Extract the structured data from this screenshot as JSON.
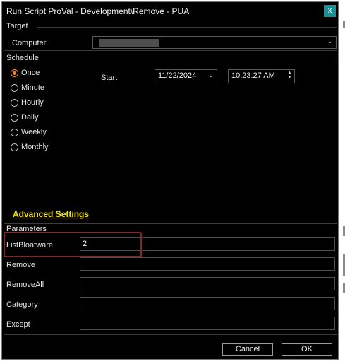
{
  "window": {
    "title": "Run Script ProVal - Development\\Remove - PUA",
    "close_glyph": "x"
  },
  "target": {
    "section": "Target",
    "computer_label": "Computer",
    "computer_value": "",
    "chevron_icon": "chevron-down-icon"
  },
  "schedule": {
    "section": "Schedule",
    "options": [
      {
        "label": "Once",
        "selected": true
      },
      {
        "label": "Minute",
        "selected": false
      },
      {
        "label": "Hourly",
        "selected": false
      },
      {
        "label": "Daily",
        "selected": false
      },
      {
        "label": "Weekly",
        "selected": false
      },
      {
        "label": "Monthly",
        "selected": false
      }
    ],
    "start_label": "Start",
    "start_date": "11/22/2024",
    "start_time": "10:23:27 AM"
  },
  "advanced_settings_label": "Advanced Settings",
  "parameters": {
    "section": "Parameters",
    "rows": [
      {
        "label": "ListBloatware",
        "value": "2"
      },
      {
        "label": "Remove",
        "value": ""
      },
      {
        "label": "RemoveAll",
        "value": ""
      },
      {
        "label": "Category",
        "value": ""
      },
      {
        "label": "Except",
        "value": ""
      }
    ]
  },
  "buttons": {
    "cancel": "Cancel",
    "ok": "OK"
  },
  "colors": {
    "accent_radio": "#e58a2c",
    "link": "#f3e600",
    "close": "#1b8f96",
    "highlight": "#7a2b2b"
  }
}
